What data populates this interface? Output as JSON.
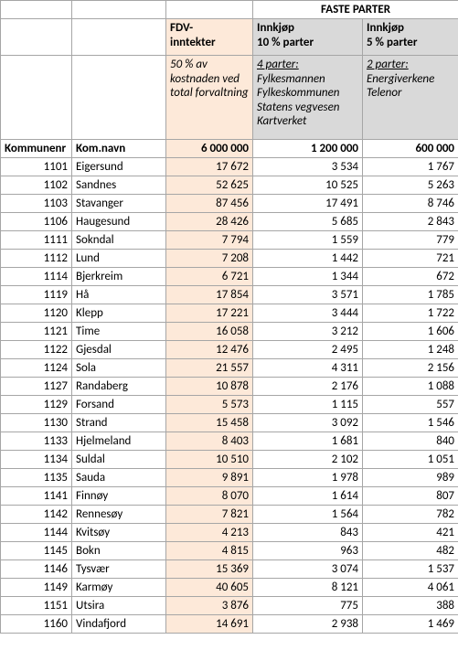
{
  "header": {
    "faste_parter": "FASTE PARTER",
    "fdv_label": "FDV-\ninntekter",
    "col1_label": "Innkjøp\n10 % parter",
    "col2_label": "Innkjøp\n5 % parter",
    "fdv_desc": "50 % av kostnaden ved total forvaltning",
    "col1_desc_title": "4 parter:",
    "col1_desc_body": "Fylkesmannen\nFylkeskommunen\nStatens vegvesen\nKartverket",
    "col2_desc_title": "2 parter:",
    "col2_desc_body": "Energiverkene\nTelenor",
    "kommunenr": "Kommunenr",
    "komnavn": "Kom.navn",
    "total_fdv": "6 000 000",
    "total_c1": "1 200 000",
    "total_c2": "600 000"
  },
  "rows": [
    {
      "nr": "1101",
      "navn": "Eigersund",
      "fdv": "17 672",
      "c1": "3 534",
      "c2": "1 767"
    },
    {
      "nr": "1102",
      "navn": "Sandnes",
      "fdv": "52 625",
      "c1": "10 525",
      "c2": "5 263"
    },
    {
      "nr": "1103",
      "navn": "Stavanger",
      "fdv": "87 456",
      "c1": "17 491",
      "c2": "8 746"
    },
    {
      "nr": "1106",
      "navn": "Haugesund",
      "fdv": "28 426",
      "c1": "5 685",
      "c2": "2 843"
    },
    {
      "nr": "1111",
      "navn": "Sokndal",
      "fdv": "7 794",
      "c1": "1 559",
      "c2": "779"
    },
    {
      "nr": "1112",
      "navn": "Lund",
      "fdv": "7 208",
      "c1": "1 442",
      "c2": "721"
    },
    {
      "nr": "1114",
      "navn": "Bjerkreim",
      "fdv": "6 721",
      "c1": "1 344",
      "c2": "672"
    },
    {
      "nr": "1119",
      "navn": "Hå",
      "fdv": "17 854",
      "c1": "3 571",
      "c2": "1 785"
    },
    {
      "nr": "1120",
      "navn": "Klepp",
      "fdv": "17 221",
      "c1": "3 444",
      "c2": "1 722"
    },
    {
      "nr": "1121",
      "navn": "Time",
      "fdv": "16 058",
      "c1": "3 212",
      "c2": "1 606"
    },
    {
      "nr": "1122",
      "navn": "Gjesdal",
      "fdv": "12 476",
      "c1": "2 495",
      "c2": "1 248"
    },
    {
      "nr": "1124",
      "navn": "Sola",
      "fdv": "21 557",
      "c1": "4 311",
      "c2": "2 156"
    },
    {
      "nr": "1127",
      "navn": "Randaberg",
      "fdv": "10 878",
      "c1": "2 176",
      "c2": "1 088"
    },
    {
      "nr": "1129",
      "navn": "Forsand",
      "fdv": "5 573",
      "c1": "1 115",
      "c2": "557"
    },
    {
      "nr": "1130",
      "navn": "Strand",
      "fdv": "15 458",
      "c1": "3 092",
      "c2": "1 546"
    },
    {
      "nr": "1133",
      "navn": "Hjelmeland",
      "fdv": "8 403",
      "c1": "1 681",
      "c2": "840"
    },
    {
      "nr": "1134",
      "navn": "Suldal",
      "fdv": "10 510",
      "c1": "2 102",
      "c2": "1 051"
    },
    {
      "nr": "1135",
      "navn": "Sauda",
      "fdv": "9 891",
      "c1": "1 978",
      "c2": "989"
    },
    {
      "nr": "1141",
      "navn": "Finnøy",
      "fdv": "8 070",
      "c1": "1 614",
      "c2": "807"
    },
    {
      "nr": "1142",
      "navn": "Rennesøy",
      "fdv": "7 821",
      "c1": "1 564",
      "c2": "782"
    },
    {
      "nr": "1144",
      "navn": "Kvitsøy",
      "fdv": "4 213",
      "c1": "843",
      "c2": "421"
    },
    {
      "nr": "1145",
      "navn": "Bokn",
      "fdv": "4 815",
      "c1": "963",
      "c2": "482"
    },
    {
      "nr": "1146",
      "navn": "Tysvær",
      "fdv": "15 369",
      "c1": "3 074",
      "c2": "1 537"
    },
    {
      "nr": "1149",
      "navn": "Karmøy",
      "fdv": "40 605",
      "c1": "8 121",
      "c2": "4 061"
    },
    {
      "nr": "1151",
      "navn": "Utsira",
      "fdv": "3 876",
      "c1": "775",
      "c2": "388"
    },
    {
      "nr": "1160",
      "navn": "Vindafjord",
      "fdv": "14 691",
      "c1": "2 938",
      "c2": "1 469"
    }
  ]
}
